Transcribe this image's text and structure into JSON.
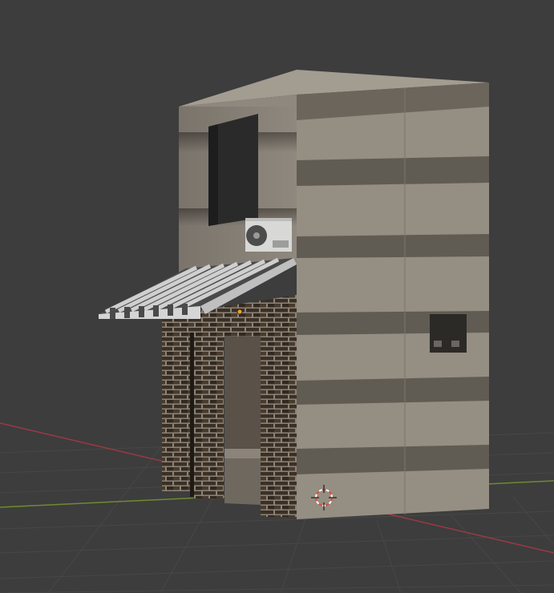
{
  "viewport": {
    "background": "#3d3d3d",
    "grid_color": "#4a4a4a",
    "x_axis_color": "#9a3a44",
    "y_axis_color": "#6f8a2e"
  },
  "scene": {
    "object": "building-model",
    "materials": {
      "concrete_light": "#9b9489",
      "concrete_dark": "#6e685f",
      "concrete_band": "#3f3a34",
      "brick_dark": "#3c3026",
      "brick_mortar": "#8a8478",
      "awning_stripe_light": "#cfcfcf",
      "awning_stripe_dark": "#4a4a4a",
      "window_dark": "#2a2a2b",
      "ac_unit": "#d8d8d6"
    },
    "origin_marker_color": "#f0a030",
    "cursor_colors": [
      "#e24a3a",
      "#ffffff"
    ]
  }
}
